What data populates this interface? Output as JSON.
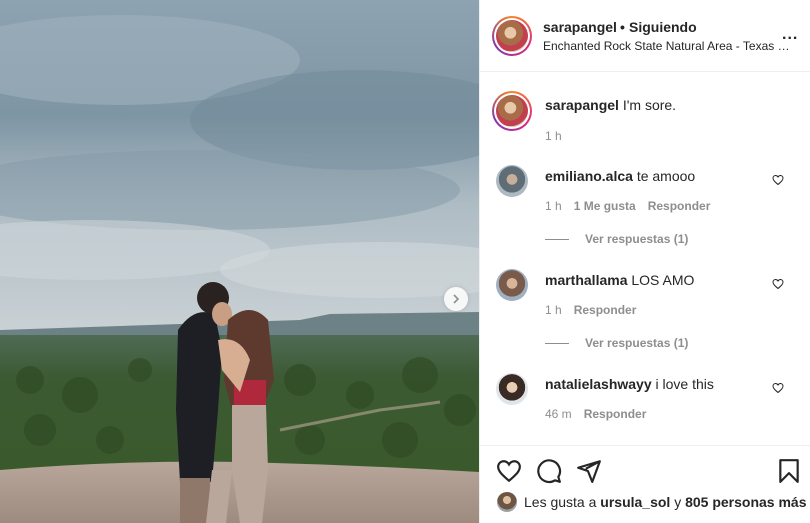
{
  "post_header": {
    "username": "sarapangel",
    "dot": "•",
    "follow_status": "Siguiendo",
    "location": "Enchanted Rock State Natural Area - Texas Pa...",
    "more": "..."
  },
  "caption": {
    "username": "sarapangel",
    "text": "I'm sore.",
    "time": "1 h"
  },
  "comments": [
    {
      "username": "emiliano.alca",
      "text": "te amooo",
      "time": "1 h",
      "likes": "1 Me gusta",
      "reply": "Responder",
      "view_replies": "Ver respuestas (1)"
    },
    {
      "username": "marthallama",
      "text": "LOS AMO",
      "time": "1 h",
      "reply": "Responder",
      "view_replies": "Ver respuestas (1)"
    },
    {
      "username": "natalielashwayy",
      "text": "i love this",
      "time": "46 m",
      "reply": "Responder"
    }
  ],
  "likes": {
    "prefix": "Les gusta a",
    "user": "ursula_sol",
    "connector": "y",
    "count": "805 personas más"
  },
  "icons": {
    "like": "heart-icon",
    "comment": "comment-icon",
    "share": "share-icon",
    "save": "bookmark-icon",
    "next": "chevron-right-icon",
    "more": "more-options-icon"
  },
  "colors": {
    "text": "#262626",
    "secondary": "#8e8e8e",
    "divider": "#efefef"
  }
}
